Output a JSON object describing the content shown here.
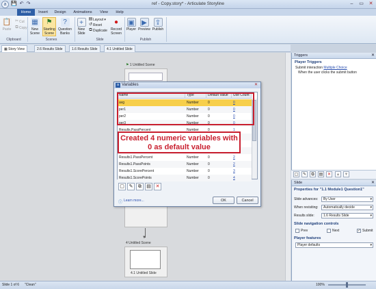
{
  "window": {
    "title": "ref - Copy.story* - Articulate Storyline",
    "logo_glyph": "a",
    "qat": [
      "💾",
      "↶",
      "↷"
    ],
    "controls": [
      "–",
      "▭",
      "✕"
    ]
  },
  "tabs": [
    "Home",
    "Insert",
    "Design",
    "Animations",
    "View",
    "Help"
  ],
  "ribbon": {
    "paste": "Paste",
    "cut": "Cut",
    "copy": "Copy",
    "starting_scene": "Starting Scene",
    "question_banks": "Question Banks",
    "new_slide": "New Slide",
    "layout": "Layout",
    "reset": "Reset",
    "duplicate": "Duplicate",
    "record_screen": "Record Screen",
    "player": "Player",
    "preview": "Preview",
    "publish": "Publish",
    "groups": [
      "Clipboard",
      "Scenes",
      "Slide",
      "Publish"
    ]
  },
  "doc_tabs": [
    "Story View",
    "2.6 Results Slide",
    "1.6 Results Slide",
    "4.1 Untitled Slide"
  ],
  "canvas": {
    "scene1_label": "1 Untitled Scene",
    "scene4_label": "4 Untitled Scene",
    "slide41_label": "4.1 Untitled Slide"
  },
  "dialog": {
    "title": "Variables",
    "columns": [
      "Name",
      "Type",
      "Default Value",
      "Use Count"
    ],
    "rows": [
      {
        "name": "avg",
        "type": "Number",
        "default": "0",
        "use": "0"
      },
      {
        "name": "per1",
        "type": "Number",
        "default": "0",
        "use": "0"
      },
      {
        "name": "per2",
        "type": "Number",
        "default": "0",
        "use": "0"
      },
      {
        "name": "per3",
        "type": "Number",
        "default": "0",
        "use": "0"
      },
      {
        "name": "Results.PassPercent",
        "type": "Number",
        "default": "0",
        "use": "1"
      },
      {
        "name": "",
        "type": "",
        "default": "",
        "use": ""
      },
      {
        "name": "",
        "type": "",
        "default": "",
        "use": ""
      },
      {
        "name": "",
        "type": "",
        "default": "",
        "use": ""
      },
      {
        "name": "Results1.PassPercent",
        "type": "Number",
        "default": "0",
        "use": "2"
      },
      {
        "name": "Results1.PassPoints",
        "type": "Number",
        "default": "0",
        "use": "2"
      },
      {
        "name": "Results1.ScorePercent",
        "type": "Number",
        "default": "0",
        "use": "3"
      },
      {
        "name": "Results1.ScorePoints",
        "type": "Number",
        "default": "0",
        "use": "4"
      }
    ],
    "learn_more": "Learn more...",
    "ok": "OK",
    "cancel": "Cancel",
    "callout": "Created 4 numeric variables with 0 as default value"
  },
  "triggers": {
    "title": "Triggers",
    "section": "Player Triggers",
    "line1_prefix": "Submit interaction",
    "line1_link": "Multiple Choice",
    "line2": "When the user clicks the submit button"
  },
  "slide_panel": {
    "title": "Slide",
    "properties_title": "Properties for \"1.1 Module1 Question1\"",
    "slide_advance_label": "Slide advances:",
    "slide_advance_value": "By User",
    "revisit_label": "When revisiting:",
    "revisit_value": "Automatically decide",
    "results_label": "Results slide:",
    "results_value": "1.6 Results Slide",
    "nav_title": "Slide navigation controls",
    "prev": "Prev",
    "next": "Next",
    "submit": "Submit",
    "player_features": "Player features",
    "player_value": "Player defaults"
  },
  "status": {
    "slide_info": "Slide 1 of 6",
    "theme": "\"Clean\"",
    "zoom": "100%"
  }
}
